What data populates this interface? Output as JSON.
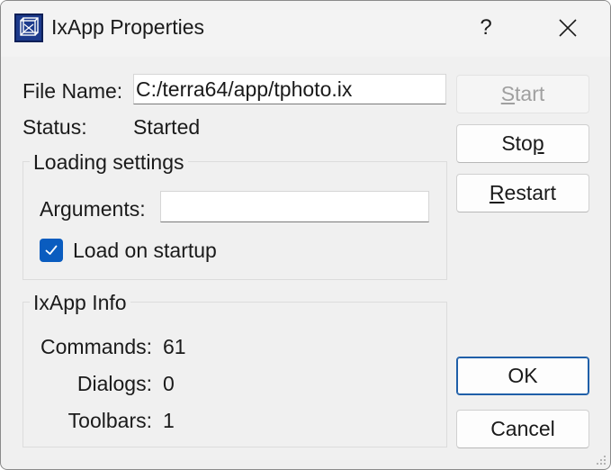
{
  "window": {
    "title": "IxApp Properties",
    "help_glyph": "?",
    "icon": "ixapp-logo-icon",
    "help_icon": "question-mark-icon",
    "close_icon": "close-icon"
  },
  "file": {
    "label": "File Name:",
    "value": "C:/terra64/app/tphoto.ix"
  },
  "status": {
    "label": "Status:",
    "value": "Started"
  },
  "loading_settings": {
    "title": "Loading settings",
    "arguments_label": "Arguments:",
    "arguments_value": "",
    "load_on_startup_label": "Load on startup",
    "load_on_startup_checked": true
  },
  "info": {
    "title": "IxApp Info",
    "rows": [
      {
        "label": "Commands:",
        "value": "61"
      },
      {
        "label": "Dialogs:",
        "value": "0"
      },
      {
        "label": "Toolbars:",
        "value": "1"
      }
    ]
  },
  "buttons": {
    "start": {
      "mnemonic": "S",
      "rest": "tart",
      "enabled": false
    },
    "stop": {
      "pre": "Sto",
      "mnemonic": "p",
      "enabled": true
    },
    "restart": {
      "mnemonic": "R",
      "rest": "estart",
      "enabled": true
    },
    "ok": {
      "label": "OK"
    },
    "cancel": {
      "label": "Cancel"
    }
  },
  "colors": {
    "accent": "#0a5cbf",
    "default_button_border": "#1f5fa8",
    "dialog_background": "#f0f0f0",
    "app_icon": "#1c3a8c"
  }
}
